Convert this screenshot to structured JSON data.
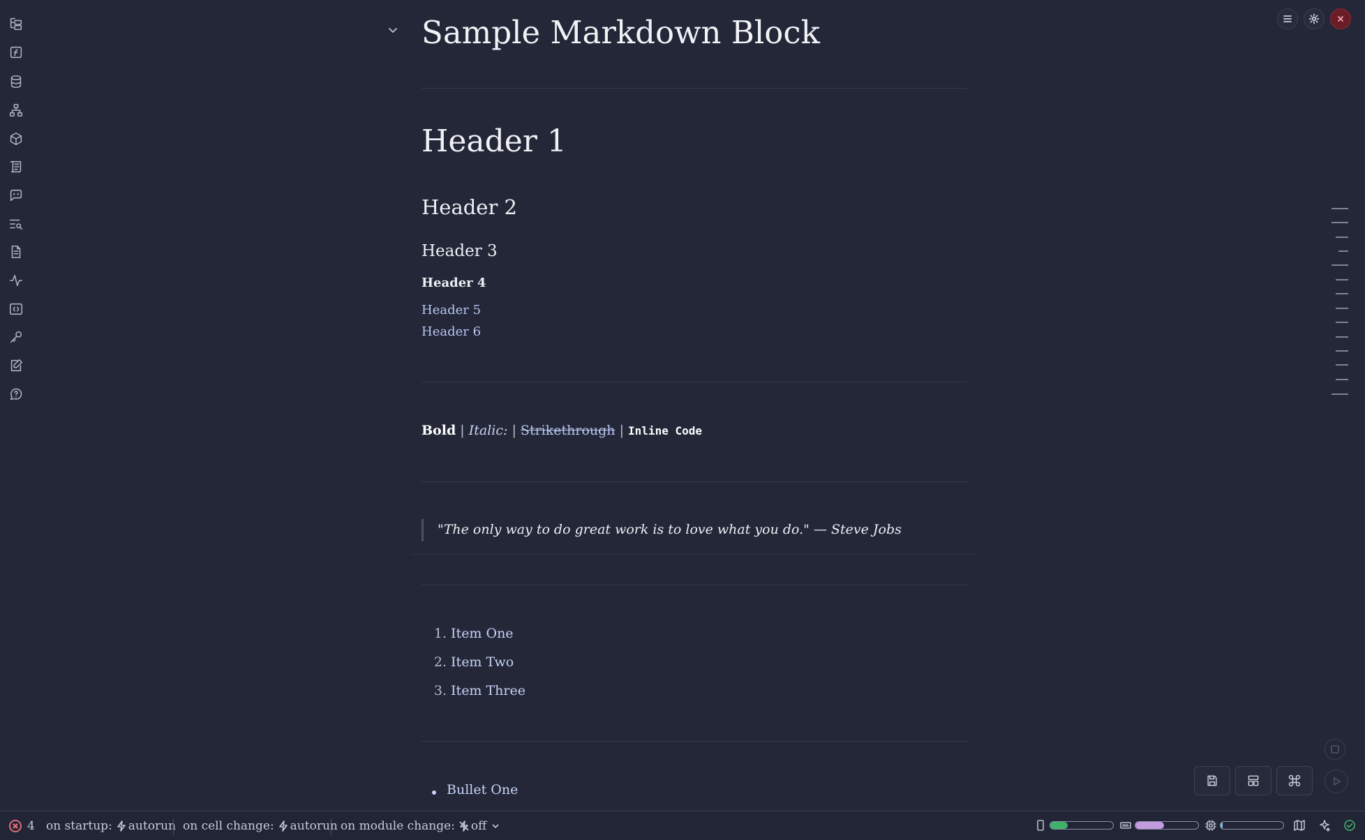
{
  "document": {
    "title": "Sample Markdown Block",
    "headers": {
      "h1": "Header 1",
      "h2": "Header 2",
      "h3": "Header 3",
      "h4": "Header 4",
      "h5": "Header 5",
      "h6": "Header 6"
    },
    "inline": {
      "bold": "Bold",
      "sep1": "|",
      "italic": "Italic:",
      "sep2": "|",
      "strikethrough": "Strikethrough",
      "sep3": "|",
      "code": "Inline Code"
    },
    "quote": "\"The only way to do great work is to love what you do.\" — Steve Jobs",
    "ordered_list": [
      {
        "num": "1.",
        "text": "Item One"
      },
      {
        "num": "2.",
        "text": "Item Two"
      },
      {
        "num": "3.",
        "text": "Item Three"
      }
    ],
    "bullet_list": [
      "Bullet One"
    ]
  },
  "sidebar_icons": [
    "file-tree-icon",
    "function-icon",
    "database-icon",
    "dependency-graph-icon",
    "package-icon",
    "outline-icon",
    "chat-icon",
    "search-list-icon",
    "document-icon",
    "activity-icon",
    "code-snippet-icon",
    "key-icon",
    "edit-note-icon",
    "help-icon"
  ],
  "statusbar": {
    "error_count": "4",
    "on_startup_label": "on startup:",
    "on_startup_value": "autorun",
    "on_cell_change_label": "on cell change:",
    "on_cell_change_value": "autorun",
    "on_module_change_label": "on module change:",
    "on_module_change_value": "off",
    "memory_fill": 0.28,
    "gpu_fill": 0.45,
    "cpu_fill": 0.03
  },
  "colors": {
    "background": "#232738",
    "heading": "#f1f2f6",
    "link_header": "#b9c7f0",
    "error": "#e06c75",
    "memory_meter": "#3fb26a",
    "gpu_meter": "#c39be0",
    "cpu_meter": "#7cc4e6",
    "success": "#3fb26a"
  }
}
